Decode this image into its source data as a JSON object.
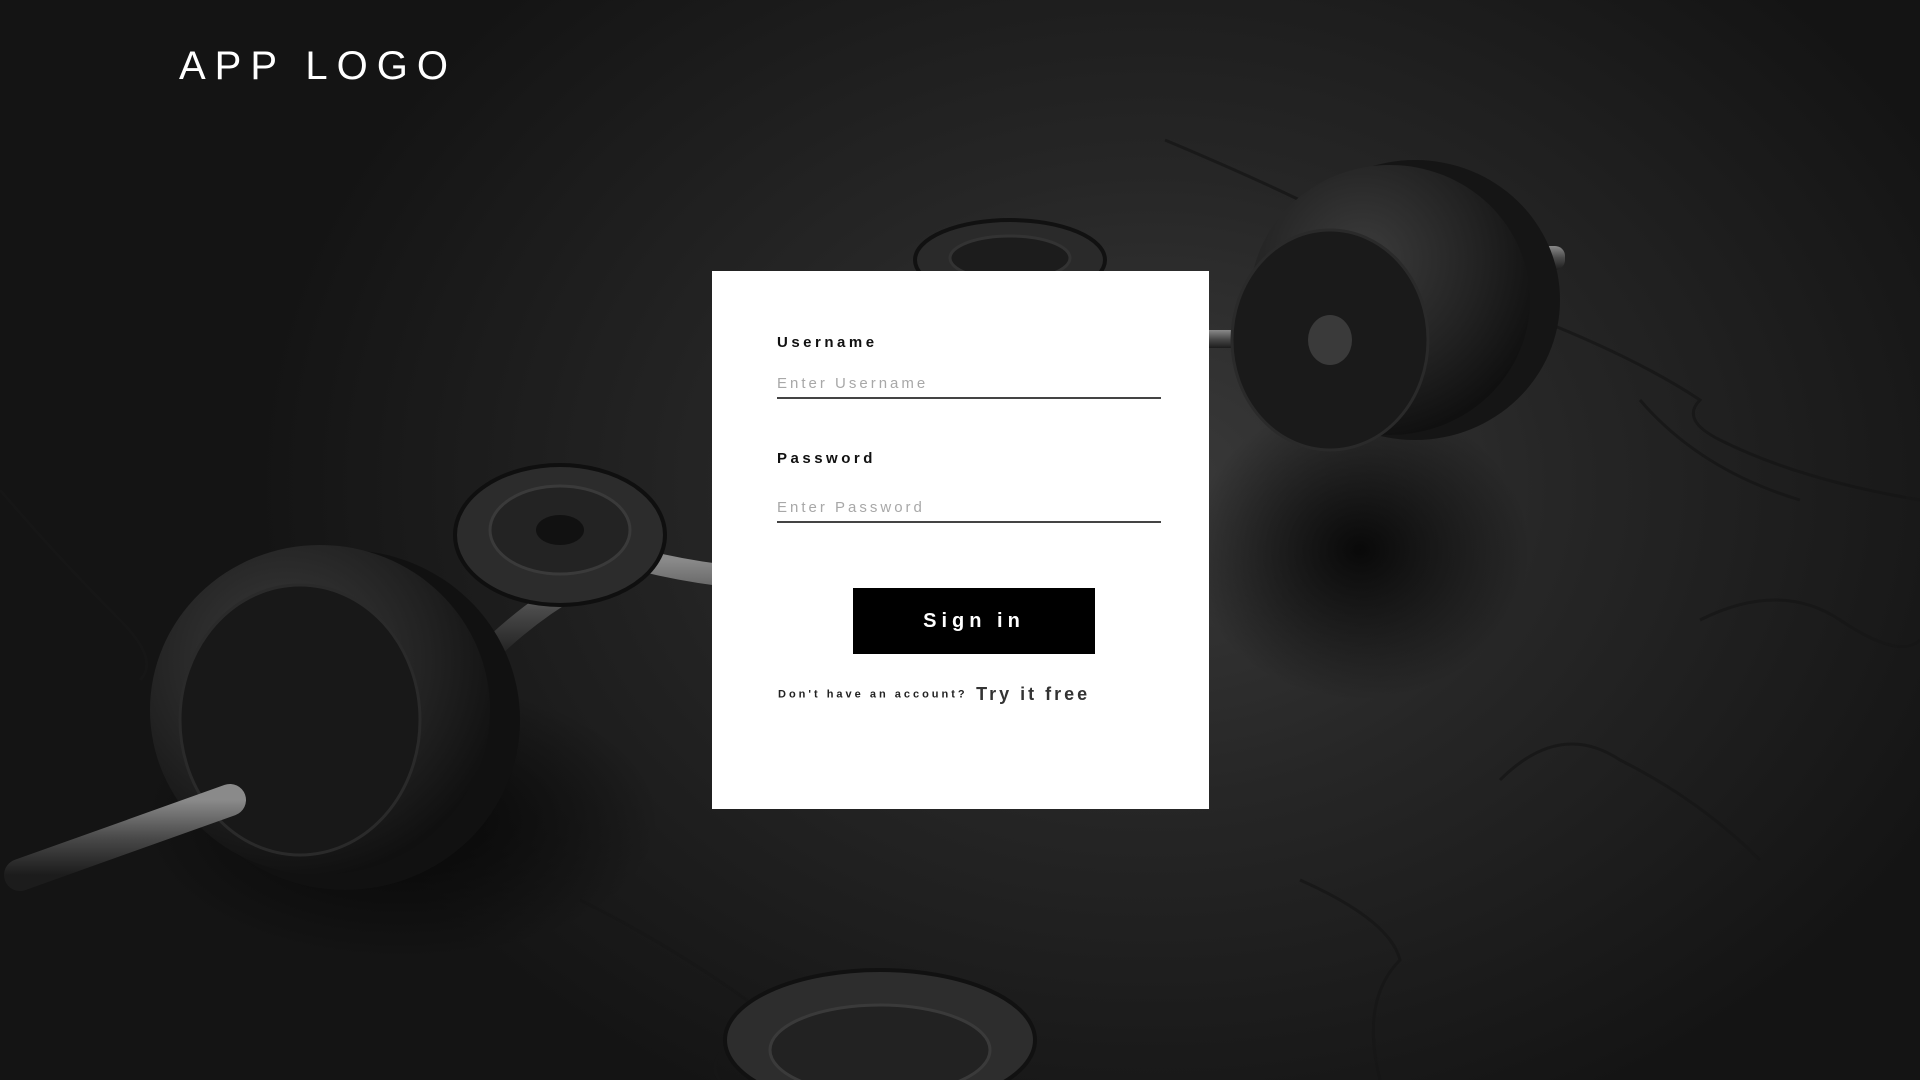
{
  "app": {
    "logo_text": "APP LOGO"
  },
  "login": {
    "username_label": "Username",
    "username_placeholder": "Enter Username",
    "username_value": "",
    "password_label": "Password",
    "password_placeholder": "Enter Password",
    "password_value": "",
    "signin_label": "Sign in",
    "signup_prompt": "Don't have an account?",
    "signup_link": "Try it free"
  },
  "colors": {
    "card_background": "#ffffff",
    "button_background": "#000000",
    "button_text": "#ffffff",
    "logo_text": "#ffffff"
  }
}
